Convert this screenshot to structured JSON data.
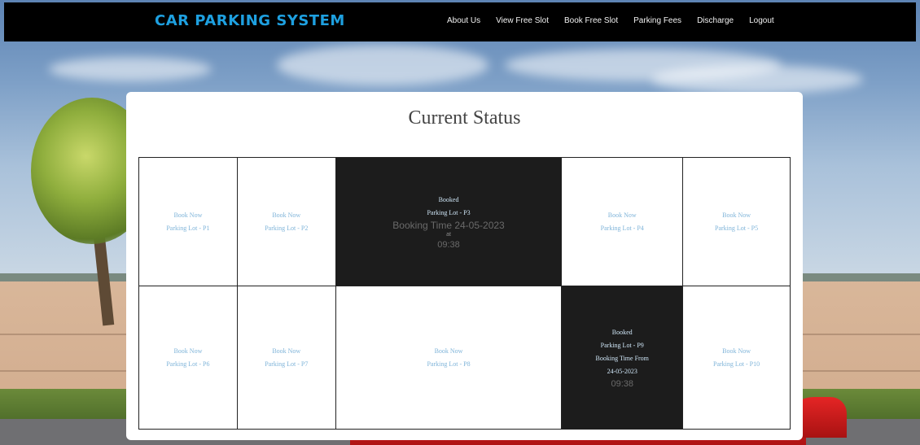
{
  "brand": "CAR PARKING SYSTEM",
  "nav": [
    "About Us",
    "View Free Slot",
    "Book Free Slot",
    "Parking Fees",
    "Discharge",
    "Logout"
  ],
  "page_title": "Current Status",
  "slots": {
    "p1": {
      "action": "Book Now",
      "lot": "Parking Lot - P1"
    },
    "p2": {
      "action": "Book Now",
      "lot": "Parking Lot - P2"
    },
    "p3": {
      "status": "Booked",
      "lot": "Parking Lot - P3",
      "time_label": "Booking Time 24-05-2023",
      "at": "at",
      "clock": "09:38"
    },
    "p4": {
      "action": "Book Now",
      "lot": "Parking Lot - P4"
    },
    "p5": {
      "action": "Book Now",
      "lot": "Parking Lot - P5"
    },
    "p6": {
      "action": "Book Now",
      "lot": "Parking Lot - P6"
    },
    "p7": {
      "action": "Book Now",
      "lot": "Parking Lot - P7"
    },
    "p8": {
      "action": "Book Now",
      "lot": "Parking Lot - P8"
    },
    "p9": {
      "status": "Booked",
      "lot": "Parking Lot - P9",
      "time_label": "Booking Time From",
      "date": "24-05-2023",
      "clock": "09:38"
    },
    "p10": {
      "action": "Book Now",
      "lot": "Parking Lot - P10"
    }
  },
  "colors": {
    "brand": "#1ea0e0",
    "link": "#7fb4d9",
    "booked_bg": "#1c1c1c",
    "navbar": "#000000"
  }
}
